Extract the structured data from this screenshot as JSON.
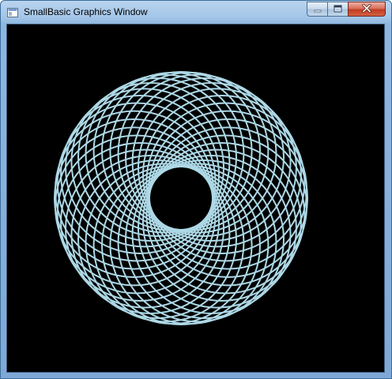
{
  "window": {
    "title": "SmallBasic Graphics Window",
    "icon": "smallbasic-app-icon",
    "controls": {
      "minimize_icon": "minimize-icon",
      "maximize_icon": "maximize-icon",
      "close_icon": "close-icon"
    }
  },
  "canvas": {
    "background_color": "#000000",
    "pattern": {
      "shape": "circle-rosette",
      "stroke_color": "#add8e6",
      "circle_count": 36
    }
  }
}
